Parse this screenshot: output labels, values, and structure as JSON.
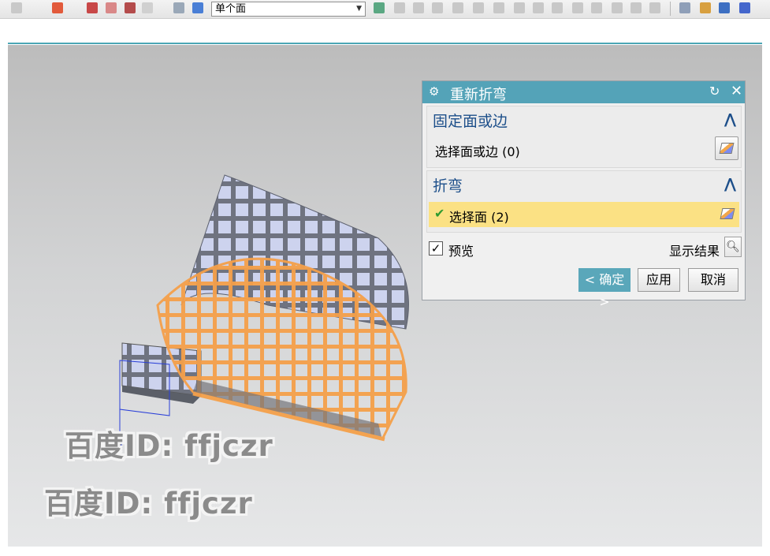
{
  "toolbar": {
    "selection_filter_value": "单个面"
  },
  "dialog": {
    "title": "重新折弯",
    "group_fixed": {
      "title": "固定面或边",
      "select_label": "选择面或边 (0)"
    },
    "group_bend": {
      "title": "折弯",
      "select_label": "选择面 (2)"
    },
    "preview_label": "预览",
    "preview_checked": true,
    "show_result_label": "显示结果",
    "ok_label": "< 确定 >",
    "apply_label": "应用",
    "cancel_label": "取消"
  },
  "watermark": {
    "line1": "百度ID: ffjczr",
    "line2": "百度ID: ffjczr"
  },
  "colors": {
    "title_bar": "#54a3b8",
    "highlight": "#fbe184",
    "bend_grid": "#f5a04a",
    "flat_grid": "#cfd4ec"
  },
  "icons": {
    "gear": "settings-icon",
    "reset": "reset-icon",
    "close": "close-icon",
    "collapse": "caret-up-icon",
    "select_face": "face-select-icon",
    "magnifier": "magnifier-icon",
    "checkmark": "green-check-icon"
  }
}
